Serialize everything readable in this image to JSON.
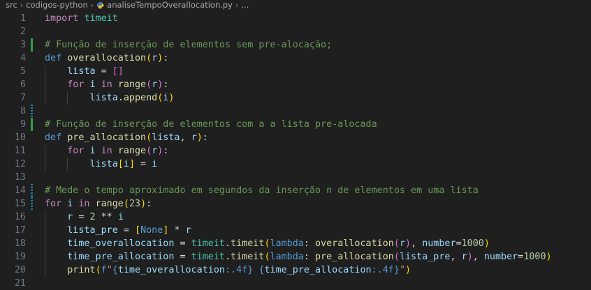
{
  "breadcrumb": {
    "items": [
      "src",
      "codigos-python",
      "analiseTempoOverallocation.py",
      "..."
    ],
    "icons": [
      "chevron-right-icon",
      "python-file-icon"
    ]
  },
  "colors": {
    "background": "#1f1f1f",
    "keyword": "#569cd6",
    "control": "#c586c0",
    "function": "#dcdcaa",
    "variable": "#9cdcfe",
    "comment": "#6a9955",
    "number": "#b5cea8",
    "string": "#ce9178",
    "gutter_added": "#2ea043",
    "gutter_modified": "#1b81a8"
  },
  "editor": {
    "lines": [
      {
        "n": "1",
        "mark": "",
        "indent": 0,
        "tokens": [
          [
            "cf",
            "import"
          ],
          [
            "pl",
            " "
          ],
          [
            "cl",
            "timeit"
          ]
        ]
      },
      {
        "n": "2",
        "mark": "",
        "indent": 0,
        "tokens": []
      },
      {
        "n": "3",
        "mark": "added",
        "indent": 0,
        "tokens": [
          [
            "cm",
            "# Função de inserção de elementos sem pre-alocação;"
          ]
        ]
      },
      {
        "n": "4",
        "mark": "",
        "indent": 0,
        "tokens": [
          [
            "kw",
            "def"
          ],
          [
            "pl",
            " "
          ],
          [
            "fn",
            "overallocation"
          ],
          [
            "br1",
            "("
          ],
          [
            "vr",
            "r"
          ],
          [
            "br1",
            ")"
          ],
          [
            "pl",
            ":"
          ]
        ]
      },
      {
        "n": "5",
        "mark": "",
        "indent": 1,
        "tokens": [
          [
            "pl",
            "    "
          ],
          [
            "vr",
            "lista"
          ],
          [
            "op",
            " = "
          ],
          [
            "br2",
            "[]"
          ]
        ]
      },
      {
        "n": "6",
        "mark": "",
        "indent": 1,
        "tokens": [
          [
            "pl",
            "    "
          ],
          [
            "cf",
            "for"
          ],
          [
            "pl",
            " "
          ],
          [
            "vr",
            "i"
          ],
          [
            "pl",
            " "
          ],
          [
            "cf",
            "in"
          ],
          [
            "pl",
            " "
          ],
          [
            "fn",
            "range"
          ],
          [
            "br2",
            "("
          ],
          [
            "vr",
            "r"
          ],
          [
            "br2",
            ")"
          ],
          [
            "pl",
            ":"
          ]
        ]
      },
      {
        "n": "7",
        "mark": "",
        "indent": 2,
        "tokens": [
          [
            "pl",
            "        "
          ],
          [
            "vr",
            "lista"
          ],
          [
            "pl",
            "."
          ],
          [
            "fn",
            "append"
          ],
          [
            "br1",
            "("
          ],
          [
            "vr",
            "i"
          ],
          [
            "br1",
            ")"
          ]
        ]
      },
      {
        "n": "8",
        "mark": "modified",
        "indent": 0,
        "tokens": []
      },
      {
        "n": "9",
        "mark": "added",
        "indent": 0,
        "tokens": [
          [
            "cm",
            "# Função de inserção de elementos com a a lista pre-alocada"
          ]
        ]
      },
      {
        "n": "10",
        "mark": "",
        "indent": 0,
        "tokens": [
          [
            "kw",
            "def"
          ],
          [
            "pl",
            " "
          ],
          [
            "fn",
            "pre_allocation"
          ],
          [
            "br1",
            "("
          ],
          [
            "vr",
            "lista"
          ],
          [
            "pl",
            ", "
          ],
          [
            "vr",
            "r"
          ],
          [
            "br1",
            ")"
          ],
          [
            "pl",
            ":"
          ]
        ]
      },
      {
        "n": "11",
        "mark": "",
        "indent": 1,
        "tokens": [
          [
            "pl",
            "    "
          ],
          [
            "cf",
            "for"
          ],
          [
            "pl",
            " "
          ],
          [
            "vr",
            "i"
          ],
          [
            "pl",
            " "
          ],
          [
            "cf",
            "in"
          ],
          [
            "pl",
            " "
          ],
          [
            "fn",
            "range"
          ],
          [
            "br2",
            "("
          ],
          [
            "vr",
            "r"
          ],
          [
            "br2",
            ")"
          ],
          [
            "pl",
            ":"
          ]
        ]
      },
      {
        "n": "12",
        "mark": "",
        "indent": 2,
        "tokens": [
          [
            "pl",
            "        "
          ],
          [
            "vr",
            "lista"
          ],
          [
            "br1",
            "["
          ],
          [
            "vr",
            "i"
          ],
          [
            "br1",
            "]"
          ],
          [
            "op",
            " = "
          ],
          [
            "vr",
            "i"
          ]
        ]
      },
      {
        "n": "13",
        "mark": "",
        "indent": 0,
        "tokens": []
      },
      {
        "n": "14",
        "mark": "modified",
        "indent": 0,
        "tokens": [
          [
            "cm",
            "# Mede o tempo aproximado em segundos da inserção n de elementos em uma lista"
          ]
        ]
      },
      {
        "n": "15",
        "mark": "modified",
        "indent": 0,
        "tokens": [
          [
            "cf",
            "for"
          ],
          [
            "pl",
            " "
          ],
          [
            "vr",
            "i"
          ],
          [
            "pl",
            " "
          ],
          [
            "cf",
            "in"
          ],
          [
            "pl",
            " "
          ],
          [
            "fn",
            "range"
          ],
          [
            "br1",
            "("
          ],
          [
            "nu",
            "23"
          ],
          [
            "br1",
            ")"
          ],
          [
            "pl",
            ":"
          ]
        ]
      },
      {
        "n": "16",
        "mark": "",
        "indent": 1,
        "tokens": [
          [
            "pl",
            "    "
          ],
          [
            "vr",
            "r"
          ],
          [
            "op",
            " = "
          ],
          [
            "nu",
            "2"
          ],
          [
            "op",
            " ** "
          ],
          [
            "vr",
            "i"
          ]
        ]
      },
      {
        "n": "17",
        "mark": "",
        "indent": 1,
        "tokens": [
          [
            "pl",
            "    "
          ],
          [
            "vr",
            "lista_pre"
          ],
          [
            "op",
            " = "
          ],
          [
            "br1",
            "["
          ],
          [
            "kw",
            "None"
          ],
          [
            "br1",
            "]"
          ],
          [
            "op",
            " * "
          ],
          [
            "vr",
            "r"
          ]
        ]
      },
      {
        "n": "18",
        "mark": "",
        "indent": 1,
        "tokens": [
          [
            "pl",
            "    "
          ],
          [
            "vr",
            "time_overallocation"
          ],
          [
            "op",
            " = "
          ],
          [
            "cl",
            "timeit"
          ],
          [
            "pl",
            "."
          ],
          [
            "fn",
            "timeit"
          ],
          [
            "br1",
            "("
          ],
          [
            "kw",
            "lambda"
          ],
          [
            "pl",
            ": "
          ],
          [
            "fn",
            "overallocation"
          ],
          [
            "br2",
            "("
          ],
          [
            "vr",
            "r"
          ],
          [
            "br2",
            ")"
          ],
          [
            "pl",
            ", "
          ],
          [
            "vr",
            "number"
          ],
          [
            "op",
            "="
          ],
          [
            "nu",
            "1000"
          ],
          [
            "br1",
            ")"
          ]
        ]
      },
      {
        "n": "19",
        "mark": "",
        "indent": 1,
        "tokens": [
          [
            "pl",
            "    "
          ],
          [
            "vr",
            "time_pre_allocation"
          ],
          [
            "op",
            " = "
          ],
          [
            "cl",
            "timeit"
          ],
          [
            "pl",
            "."
          ],
          [
            "fn",
            "timeit"
          ],
          [
            "br1",
            "("
          ],
          [
            "kw",
            "lambda"
          ],
          [
            "pl",
            ": "
          ],
          [
            "fn",
            "pre_allocation"
          ],
          [
            "br2",
            "("
          ],
          [
            "vr",
            "lista_pre"
          ],
          [
            "pl",
            ", "
          ],
          [
            "vr",
            "r"
          ],
          [
            "br2",
            ")"
          ],
          [
            "pl",
            ", "
          ],
          [
            "vr",
            "number"
          ],
          [
            "op",
            "="
          ],
          [
            "nu",
            "1000"
          ],
          [
            "br1",
            ")"
          ]
        ]
      },
      {
        "n": "20",
        "mark": "",
        "indent": 1,
        "tokens": [
          [
            "pl",
            "    "
          ],
          [
            "fn",
            "print"
          ],
          [
            "br1",
            "("
          ],
          [
            "kw",
            "f"
          ],
          [
            "st",
            "\""
          ],
          [
            "kw",
            "{"
          ],
          [
            "vr",
            "time_overallocation"
          ],
          [
            "kw",
            ":.4f}"
          ],
          [
            "st",
            " "
          ],
          [
            "kw",
            "{"
          ],
          [
            "vr",
            "time_pre_allocation"
          ],
          [
            "kw",
            ":.4f}"
          ],
          [
            "st",
            "\""
          ],
          [
            "br1",
            ")"
          ]
        ]
      },
      {
        "n": "21",
        "mark": "",
        "indent": 0,
        "tokens": []
      }
    ]
  }
}
